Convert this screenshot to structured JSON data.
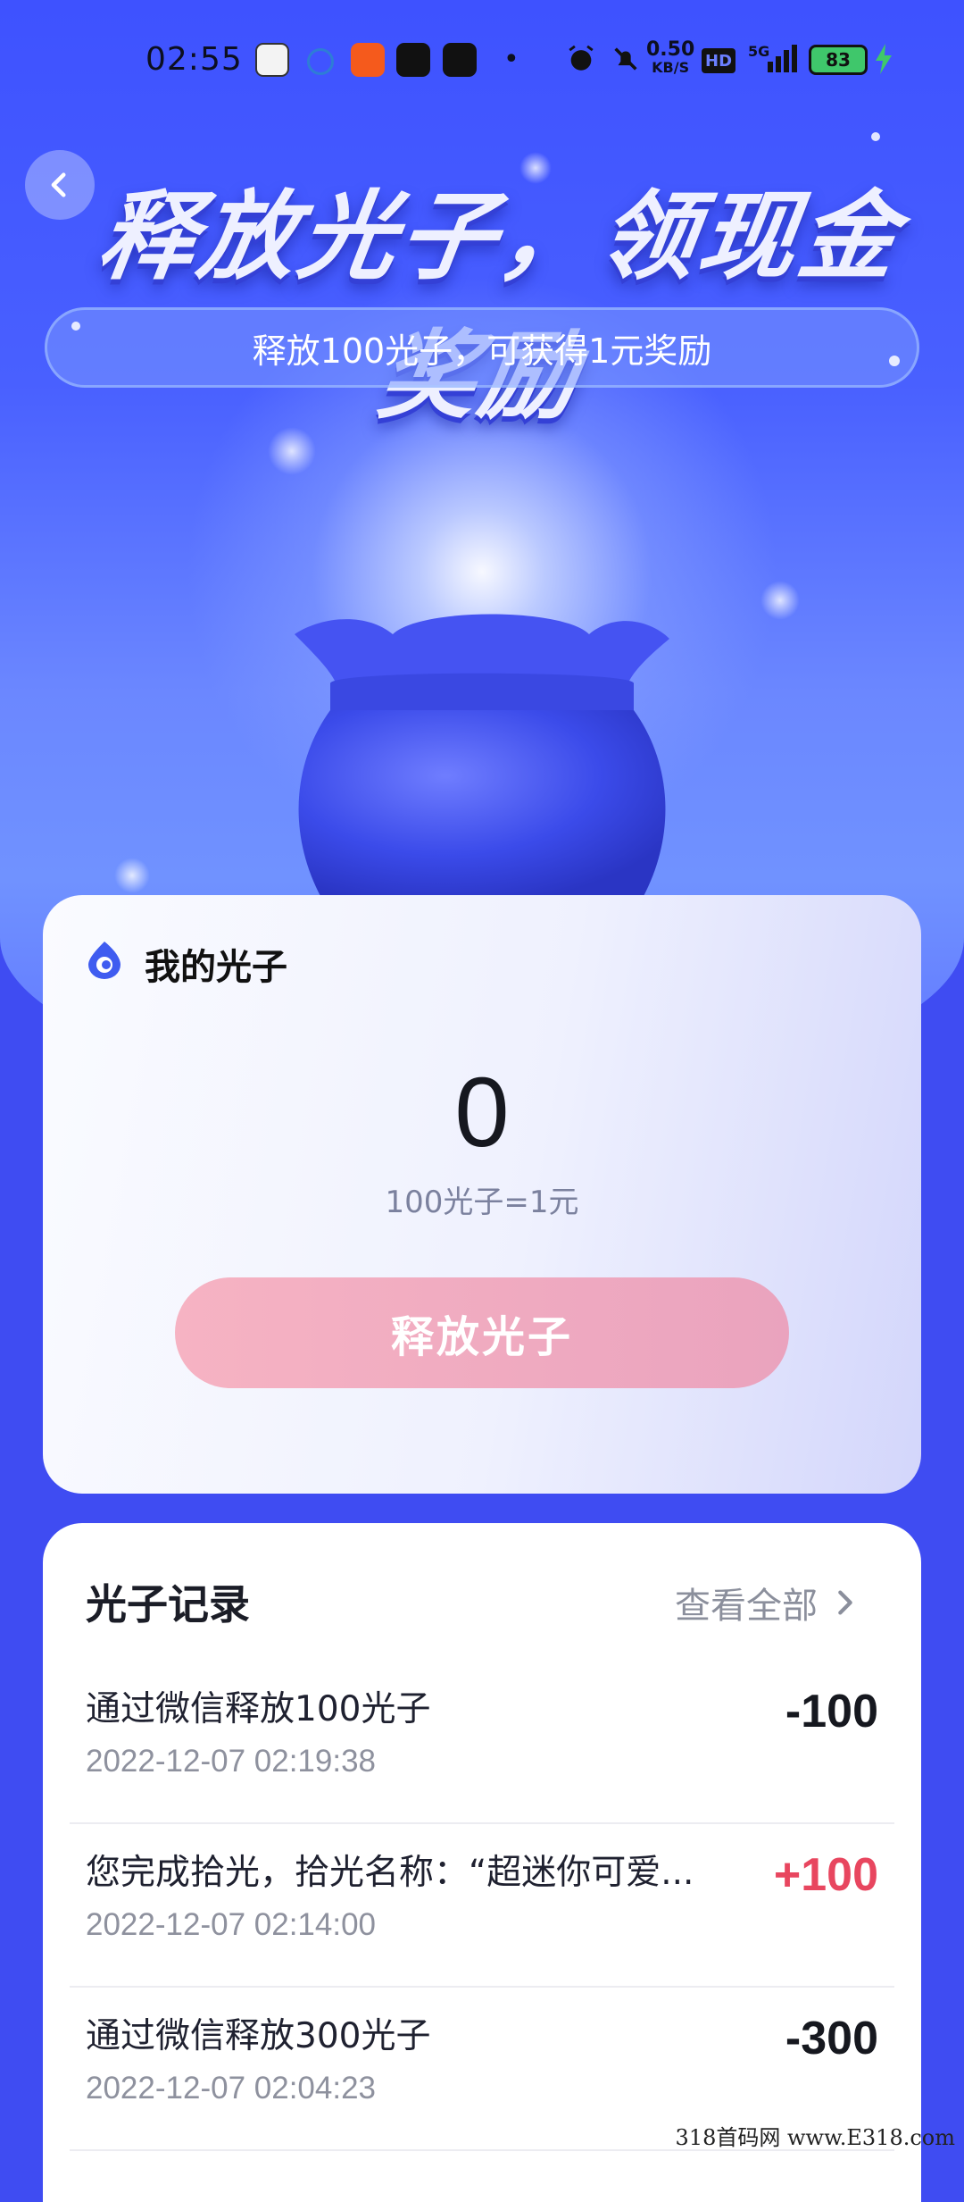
{
  "status_bar": {
    "time": "02:55",
    "net_speed_value": "0.50",
    "net_speed_unit": "KB/S",
    "hd": "HD",
    "signal": "5G",
    "battery": "83",
    "dot": "•"
  },
  "hero": {
    "headline": "释放光子，领现金奖励",
    "subtitle": "释放100光子，可获得1元奖励"
  },
  "photon_card": {
    "title": "我的光子",
    "balance": "0",
    "rate": "100光子=1元",
    "release_button": "释放光子"
  },
  "records": {
    "title": "光子记录",
    "view_all": "查看全部",
    "items": [
      {
        "desc": "通过微信释放100光子",
        "time": "2022-12-07 02:19:38",
        "amount": "-100",
        "color": "#16181f"
      },
      {
        "desc": "您完成拾光，拾光名称：“超迷你可爱...",
        "time": "2022-12-07 02:14:00",
        "amount": "+100",
        "color": "#e8465f"
      },
      {
        "desc": "通过微信释放300光子",
        "time": "2022-12-07 02:04:23",
        "amount": "-300",
        "color": "#16181f"
      }
    ]
  },
  "watermark": "318首码网 www.E318.com",
  "icons": {
    "back": "back-arrow-icon",
    "photon": "photon-logo-icon",
    "chevron": "chevron-right-icon"
  }
}
